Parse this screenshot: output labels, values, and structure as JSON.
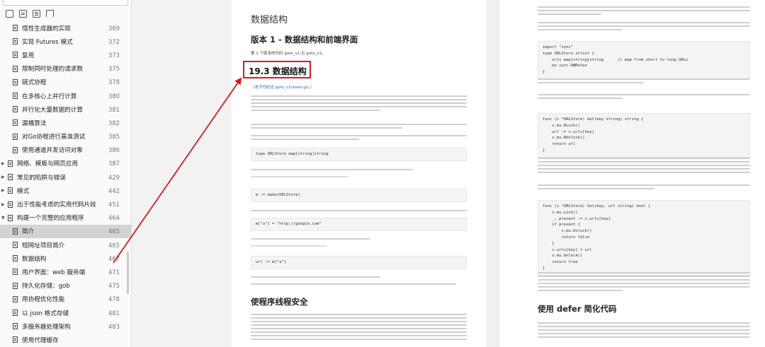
{
  "sidebar": {
    "items": [
      {
        "label": "惰性生成器的实现",
        "page": "369",
        "level": 2,
        "active": false
      },
      {
        "label": "实现 Futures 模式",
        "page": "372",
        "level": 2,
        "active": false
      },
      {
        "label": "复用",
        "page": "373",
        "level": 2,
        "active": false
      },
      {
        "label": "限制同时处理的请求数",
        "page": "375",
        "level": 2,
        "active": false
      },
      {
        "label": "链式协程",
        "page": "378",
        "level": 2,
        "active": false
      },
      {
        "label": "在多核心上并行计算",
        "page": "380",
        "level": 2,
        "active": false
      },
      {
        "label": "并行化大量数据的计算",
        "page": "381",
        "level": 2,
        "active": false
      },
      {
        "label": "漏桶算法",
        "page": "382",
        "level": 2,
        "active": false
      },
      {
        "label": "对Go协程进行基准测试",
        "page": "385",
        "level": 2,
        "active": false
      },
      {
        "label": "使用通道并发访问对象",
        "page": "386",
        "level": 2,
        "active": false
      },
      {
        "label": "网络、模板与网页应用",
        "page": "387",
        "level": 1,
        "active": false
      },
      {
        "label": "常见的陷阱与错误",
        "page": "429",
        "level": 1,
        "active": false
      },
      {
        "label": "模式",
        "page": "442",
        "level": 1,
        "active": false
      },
      {
        "label": "出于性能考虑的实用代码片段",
        "page": "451",
        "level": 1,
        "active": false
      },
      {
        "label": "构建一个完整的应用程序",
        "page": "464",
        "level": 1,
        "active": false,
        "expanded": true
      },
      {
        "label": "简介",
        "page": "465",
        "level": 2,
        "active": true
      },
      {
        "label": "短网址项目简介",
        "page": "465",
        "level": 2,
        "active": false
      },
      {
        "label": "数据结构",
        "page": "467",
        "level": 2,
        "active": false
      },
      {
        "label": "用户界面：web 服务端",
        "page": "471",
        "level": 2,
        "active": false
      },
      {
        "label": "持久化存储：gob",
        "page": "475",
        "level": 2,
        "active": false
      },
      {
        "label": "用协程优化性能",
        "page": "478",
        "level": 2,
        "active": false
      },
      {
        "label": "以 json 格式存储",
        "page": "481",
        "level": 2,
        "active": false
      },
      {
        "label": "多服务器处理架构",
        "page": "483",
        "level": 2,
        "active": false
      },
      {
        "label": "使用代理缓存",
        "page": "",
        "level": 2,
        "active": false
      }
    ]
  },
  "left_page": {
    "chapter_title": "数据结构",
    "version_title": "版本 1 - 数据结构和前端界面",
    "intro": "第 1 个版本的代码 goto_v1 见 goto_v1。",
    "section_title": "19.3 数据结构",
    "code_ref": "（本节代码见 goto_v1/store.go。）",
    "code1": "type URLStore map[string]string",
    "code2": "m := make(URLStore)",
    "code3": "m[\"a\"] = \"http://google.com\"",
    "code4": "url := m[\"a\"]",
    "subheading": "使程序线程安全"
  },
  "right_page": {
    "code_struct": [
      "import \"sync\"",
      "type URLStore struct {",
      "    urls map[string]string      // map from short to long URLs",
      "    mu sync.RWMutex",
      "}"
    ],
    "code_get": [
      "func (s *URLStore) Get(key string) string {",
      "    s.mu.RLock()",
      "    url := s.urls[key]",
      "    s.mu.RUnlock()",
      "    return url",
      "}"
    ],
    "code_set": [
      "func (s *URLStore) Set(key, url string) bool {",
      "    s.mu.Lock()",
      "    _, present := s.urls[key]",
      "    if present {",
      "        s.mu.Unlock()",
      "        return false",
      "    }",
      "    s.urls[key] = url",
      "    s.mu.Unlock()",
      "    return true",
      "}"
    ],
    "subheading": "使用 defer 简化代码"
  }
}
